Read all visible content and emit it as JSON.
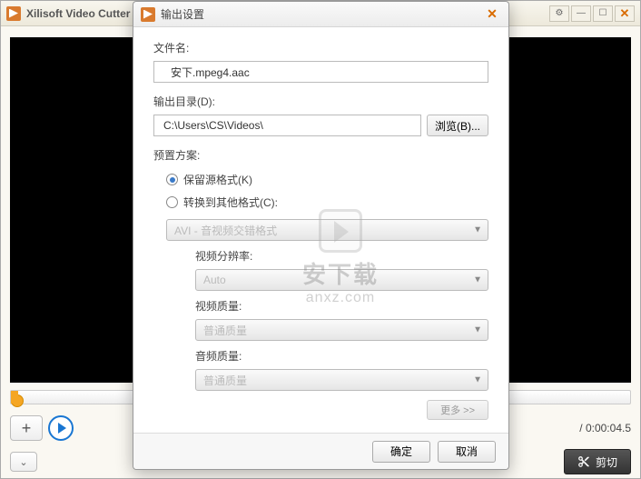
{
  "main": {
    "title": "Xilisoft Video Cutter 2 - 安下.mpeg4.aac.mp4",
    "time_display": "/ 0:00:04.5",
    "add_label": "+",
    "cut_label": "剪切",
    "expand_glyph": "⌄"
  },
  "dialog": {
    "title": "输出设置",
    "filename_label": "文件名:",
    "filename_value": "安下.mpeg4.aac",
    "outdir_label": "输出目录(D):",
    "outdir_value": "C:\\Users\\CS\\Videos\\",
    "browse_label": "浏览(B)...",
    "preset_label": "预置方案:",
    "radio_keep": "保留源格式(K)",
    "radio_convert": "转换到其他格式(C):",
    "format_value": "AVI - 音视频交错格式",
    "video_res_label": "视频分辨率:",
    "video_res_value": "Auto",
    "video_quality_label": "视频质量:",
    "video_quality_value": "普通质量",
    "audio_quality_label": "音频质量:",
    "audio_quality_value": "普通质量",
    "more_label": "更多 >>",
    "ok_label": "确定",
    "cancel_label": "取消"
  },
  "watermark": {
    "line1": "安下载",
    "line2": "anxz.com"
  }
}
